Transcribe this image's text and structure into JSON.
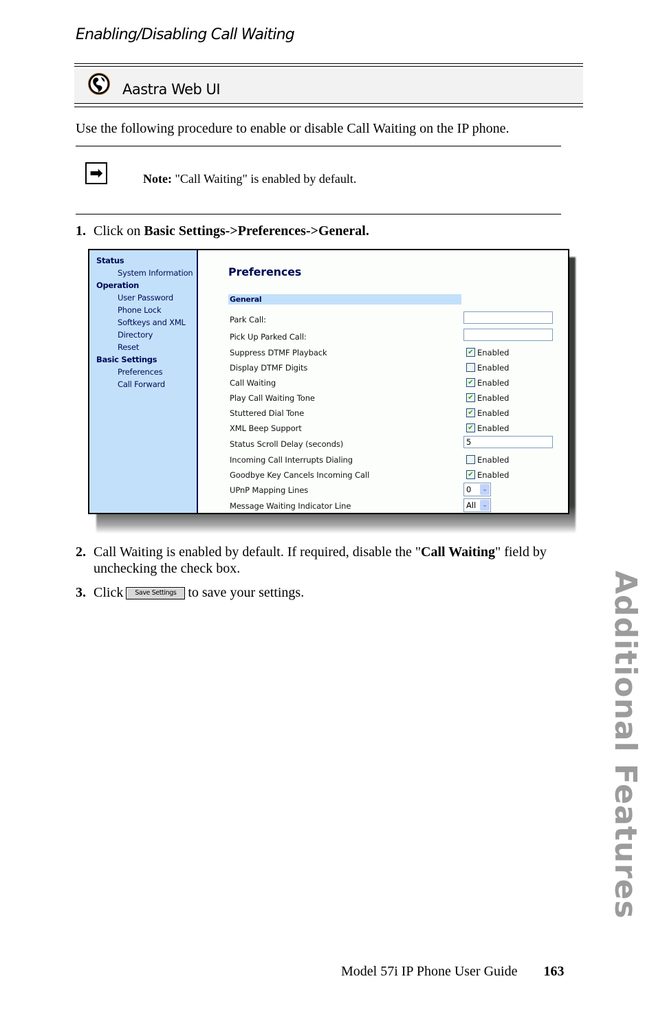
{
  "section_title": "Enabling/Disabling Call Waiting",
  "banner": {
    "icon": "globe-icon",
    "label": "Aastra Web UI"
  },
  "intro": "Use the following procedure to enable or disable Call Waiting on the IP phone.",
  "note": {
    "icon": "arrow-right-icon",
    "prefix": "Note:",
    "text": " \"Call Waiting\" is enabled by default."
  },
  "steps": {
    "s1": {
      "num": "1.",
      "text": "Click on ",
      "bold": "Basic Settings->Preferences->General."
    },
    "s2": {
      "num": "2.",
      "text_a": "Call Waiting is enabled by default. If required, disable the \"",
      "bold": "Call Waiting",
      "text_b": "\" field by",
      "text_c": "unchecking the check box."
    },
    "s3": {
      "num": "3.",
      "text_a": "Click",
      "button": "Save Settings",
      "text_b": "to save your settings."
    }
  },
  "webui": {
    "nav": [
      {
        "type": "group",
        "label": "Status"
      },
      {
        "type": "item",
        "label": "System Information"
      },
      {
        "type": "group",
        "label": "Operation"
      },
      {
        "type": "item",
        "label": "User Password"
      },
      {
        "type": "item",
        "label": "Phone Lock"
      },
      {
        "type": "item",
        "label": "Softkeys and XML"
      },
      {
        "type": "item",
        "label": "Directory"
      },
      {
        "type": "item",
        "label": "Reset"
      },
      {
        "type": "group",
        "label": "Basic Settings"
      },
      {
        "type": "item",
        "label": "Preferences"
      },
      {
        "type": "item",
        "label": "Call Forward"
      }
    ],
    "page_title": "Preferences",
    "group_header": "General",
    "checkbox_label": "Enabled",
    "fields": [
      {
        "label": "Park Call:",
        "type": "text",
        "value": ""
      },
      {
        "label": "Pick Up Parked Call:",
        "type": "text",
        "value": ""
      },
      {
        "label": "Suppress DTMF Playback",
        "type": "checkbox",
        "checked": true
      },
      {
        "label": "Display DTMF Digits",
        "type": "checkbox",
        "checked": false
      },
      {
        "label": "Call Waiting",
        "type": "checkbox",
        "checked": true
      },
      {
        "label": "Play Call Waiting Tone",
        "type": "checkbox",
        "checked": true
      },
      {
        "label": "Stuttered Dial Tone",
        "type": "checkbox",
        "checked": true
      },
      {
        "label": "XML Beep Support",
        "type": "checkbox",
        "checked": true
      },
      {
        "label": "Status Scroll Delay (seconds)",
        "type": "text",
        "value": "5"
      },
      {
        "label": "Incoming Call Interrupts Dialing",
        "type": "checkbox",
        "checked": false
      },
      {
        "label": "Goodbye Key Cancels Incoming Call",
        "type": "checkbox",
        "checked": true
      },
      {
        "label": "UPnP Mapping Lines",
        "type": "select",
        "value": "0"
      },
      {
        "label": "Message Waiting Indicator Line",
        "type": "select",
        "value": "All"
      }
    ]
  },
  "side_tab": "Additional Features",
  "footer": {
    "guide": "Model 57i IP Phone User Guide",
    "page": "163"
  }
}
